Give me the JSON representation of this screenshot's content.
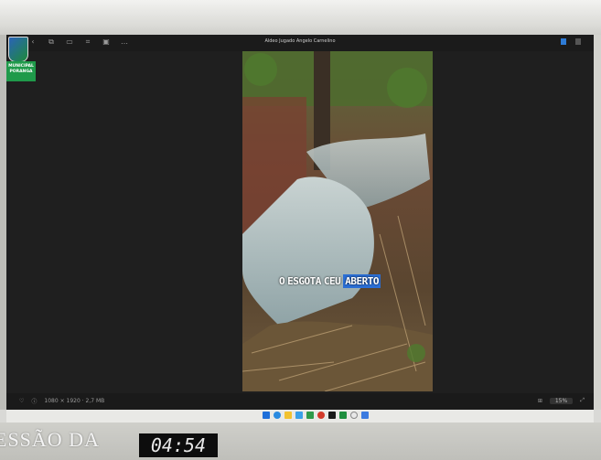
{
  "viewer": {
    "title": "Aldeo Jugado Angelo Carnelino",
    "toolbar_icons": [
      "back-icon",
      "copy-icon",
      "window-icon",
      "crop-icon",
      "image-icon",
      "more-icon"
    ],
    "status_left": "1080 × 1920 · 2,7 MB",
    "zoom": "15%"
  },
  "logo": {
    "text": "MUNICIPAL\nPORANGA"
  },
  "video": {
    "caption_words": [
      "O",
      "ESGOTA",
      "CEU",
      "ABERTO"
    ],
    "highlight_word": "ABERTO"
  },
  "overlay": {
    "session_text": "ESSÃO DA",
    "timer": "04:54"
  },
  "colors": {
    "caption_highlight": "#2b6fd6",
    "logo_green": "#1f9a4a",
    "screen_bg": "#1f1f1f"
  }
}
